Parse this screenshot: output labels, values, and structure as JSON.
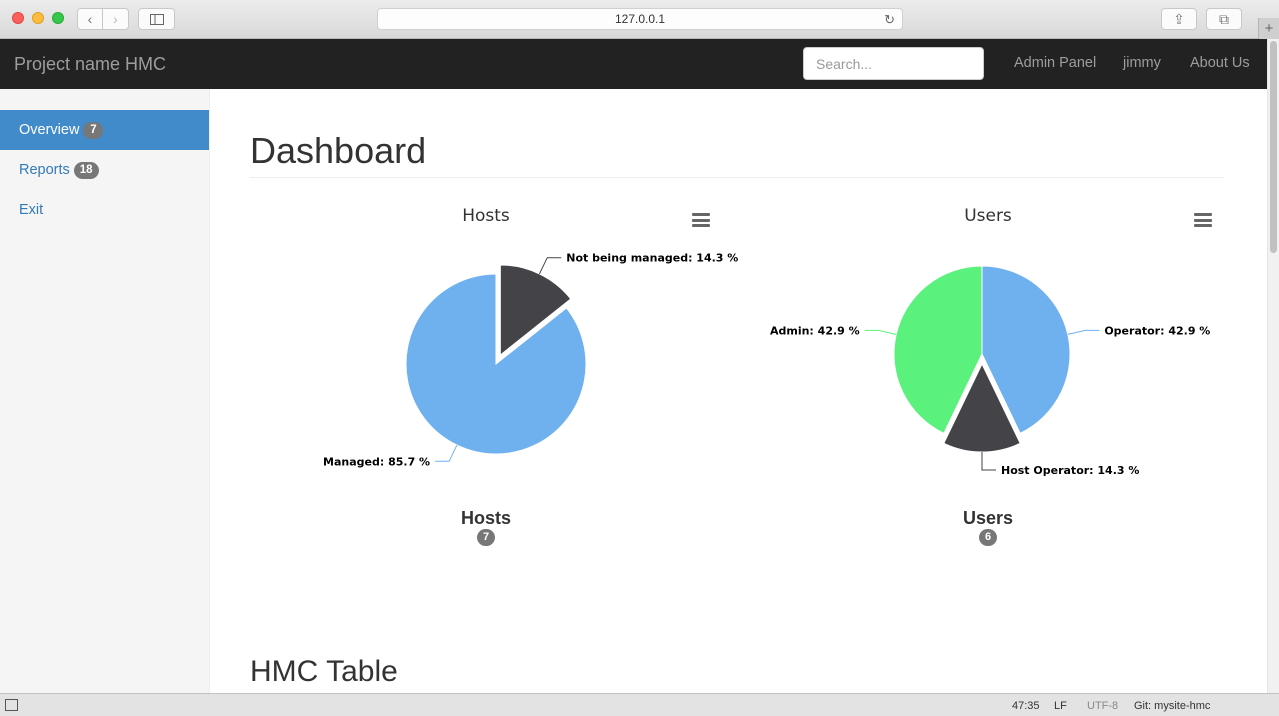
{
  "browser": {
    "url": "127.0.0.1",
    "back_glyph": "‹",
    "forward_glyph": "›",
    "reload_glyph": "↻",
    "share_glyph": "⇪",
    "tabs_glyph": "⧉",
    "newtab_glyph": "+"
  },
  "navbar": {
    "brand": "Project name HMC",
    "search_placeholder": "Search...",
    "links": [
      "Admin Panel",
      "jimmy",
      "About Us"
    ]
  },
  "sidebar": {
    "items": [
      {
        "label": "Overview",
        "badge": "7",
        "active": true
      },
      {
        "label": "Reports",
        "badge": "18",
        "active": false
      },
      {
        "label": "Exit",
        "badge": "",
        "active": false
      }
    ]
  },
  "main": {
    "title": "Dashboard",
    "section_title": "HMC Table",
    "stats": [
      {
        "title": "Hosts",
        "count": "7"
      },
      {
        "title": "Users",
        "count": "6"
      }
    ]
  },
  "colors": {
    "blue": "#6fb1ee",
    "dark": "#434348",
    "green": "#5af17c"
  },
  "chart_data": [
    {
      "type": "pie",
      "title": "Hosts",
      "slices": [
        {
          "name": "Not being managed",
          "value": 14.3,
          "label": "Not being managed: 14.3 %",
          "color": "#434348",
          "sliced": true
        },
        {
          "name": "Managed",
          "value": 85.7,
          "label": "Managed: 85.7 %",
          "color": "#6fb1ee",
          "sliced": false
        }
      ]
    },
    {
      "type": "pie",
      "title": "Users",
      "slices": [
        {
          "name": "Operator",
          "value": 42.9,
          "label": "Operator: 42.9 %",
          "color": "#6fb1ee",
          "sliced": false
        },
        {
          "name": "Host Operator",
          "value": 14.3,
          "label": "Host Operator: 14.3 %",
          "color": "#434348",
          "sliced": true
        },
        {
          "name": "Admin",
          "value": 42.9,
          "label": "Admin: 42.9 %",
          "color": "#5af17c",
          "sliced": false
        }
      ]
    }
  ],
  "statusbar": {
    "position": "47:35",
    "line_ending": "LF",
    "encoding": "UTF-8",
    "git": "Git: mysite-hmc"
  }
}
